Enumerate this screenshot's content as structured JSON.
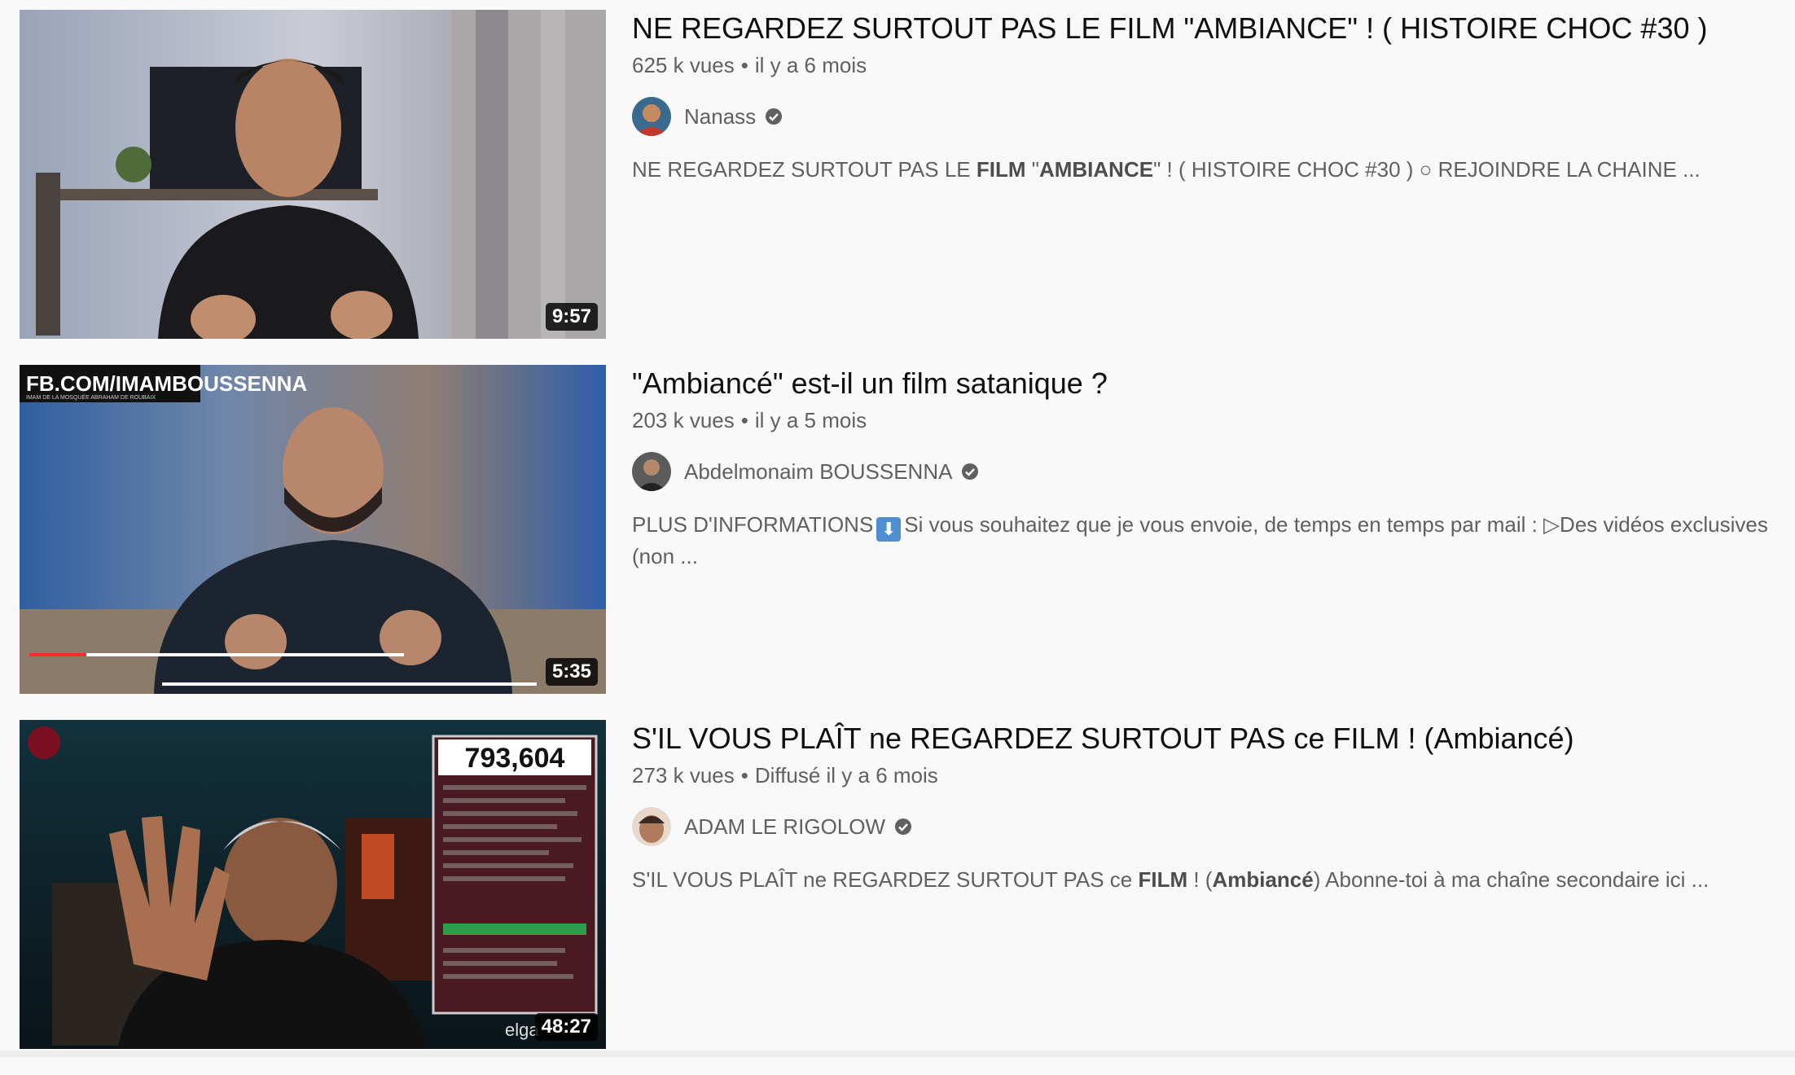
{
  "results": [
    {
      "title": "NE REGARDEZ SURTOUT PAS LE FILM \"AMBIANCE\" ! ( HISTOIRE CHOC #30 )",
      "views": "625 k vues",
      "age": "il y a 6 mois",
      "channel": "Nanass",
      "verified": true,
      "duration": "9:57",
      "desc_parts": [
        {
          "text": "NE REGARDEZ SURTOUT PAS LE ",
          "bold": false
        },
        {
          "text": "FILM",
          "bold": true
        },
        {
          "text": " \"",
          "bold": false
        },
        {
          "text": "AMBIANCE",
          "bold": true
        },
        {
          "text": "\" ! ( HISTOIRE CHOC #30 ) ○ REJOINDRE LA CHAINE ...",
          "bold": false
        }
      ]
    },
    {
      "title": "\"Ambiancé\" est-il un film satanique ?",
      "views": "203 k vues",
      "age": "il y a 5 mois",
      "channel": "Abdelmonaim BOUSSENNA",
      "verified": true,
      "duration": "5:35",
      "thumb_overlay": "FB.COM/IMAMBOUSSENNA",
      "thumb_subtitle": "IMAM DE LA MOSQUÉE ABRAHAM DE ROUBAIX",
      "desc_before": "PLUS D'INFORMATIONS",
      "desc_emoji": "⬇",
      "desc_after": "Si vous souhaitez que je vous envoie, de temps en temps par mail : ▷Des vidéos exclusives (non ..."
    },
    {
      "title": "S'IL VOUS PLAÎT ne REGARDEZ SURTOUT PAS ce FILM ! (Ambiancé)",
      "views": "273 k vues",
      "age": "Diffusé il y a 6 mois",
      "channel": "ADAM LE RIGOLOW",
      "verified": true,
      "duration": "48:27",
      "thumb_counter": "793,604",
      "thumb_watermark": "elga",
      "desc_parts": [
        {
          "text": "S'IL VOUS PLAÎT ne REGARDEZ SURTOUT PAS ce ",
          "bold": false
        },
        {
          "text": "FILM",
          "bold": true
        },
        {
          "text": " ! (",
          "bold": false
        },
        {
          "text": "Ambiancé",
          "bold": true
        },
        {
          "text": ") Abonne-toi à ma chaîne secondaire ici ...",
          "bold": false
        }
      ]
    }
  ],
  "separator": "•"
}
